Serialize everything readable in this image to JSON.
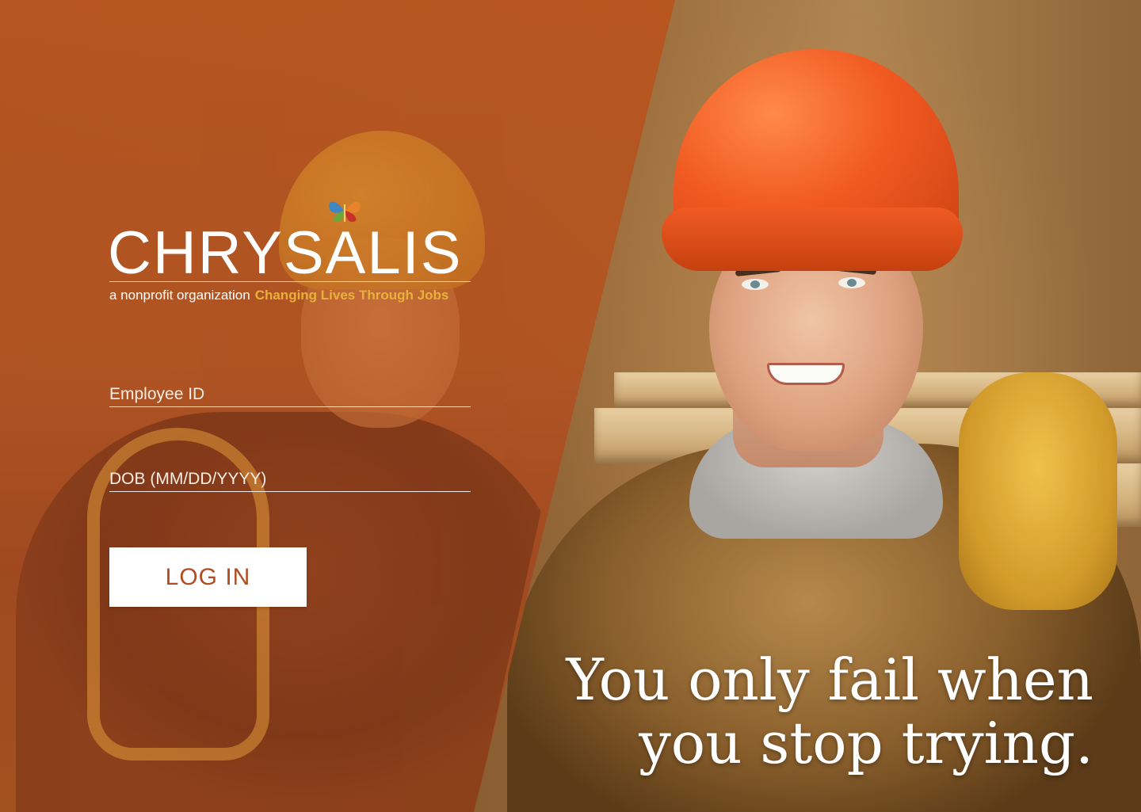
{
  "brand": {
    "name": "CHRYSALIS",
    "tagline_prefix": "a nonprofit organization",
    "tagline_highlight": "Changing Lives Through Jobs",
    "logo_icon": "butterfly-icon"
  },
  "form": {
    "employee_id": {
      "placeholder": "Employee ID",
      "value": ""
    },
    "dob": {
      "placeholder": "DOB (MM/DD/YYYY)",
      "value": ""
    },
    "login_label": "LOG IN"
  },
  "quote": {
    "line1": "You only fail when",
    "line2": "you stop trying."
  },
  "colors": {
    "overlay": "#b15423",
    "button_text": "#b04d22",
    "tagline_highlight": "#e8b23a",
    "helmet": "#f15a22"
  }
}
